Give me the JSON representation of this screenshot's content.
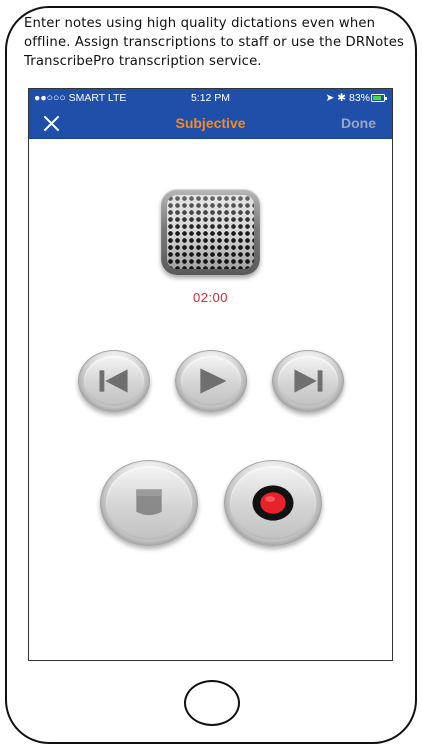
{
  "caption": {
    "line1": "Enter notes using high quality dictations even when",
    "line2": "offline. Assign transcriptions to staff or use the DRNotes",
    "line3": "TranscribePro transcription service."
  },
  "statusbar": {
    "carrier": "●●○○○ SMART  LTE",
    "time": "5:12 PM",
    "indicators": "➤ ✱ 83%"
  },
  "navbar": {
    "close_icon": "close-icon",
    "title": "Subjective",
    "done_label": "Done"
  },
  "recorder": {
    "timer": "02:00",
    "controls": [
      "skip-back-icon",
      "play-icon",
      "skip-forward-icon",
      "stop-icon",
      "record-icon"
    ]
  },
  "colors": {
    "navbar": "#1f4fa8",
    "title": "#f08a2a",
    "done": "#9aa7c4",
    "timer": "#d9272e",
    "record": "#e8222a"
  }
}
